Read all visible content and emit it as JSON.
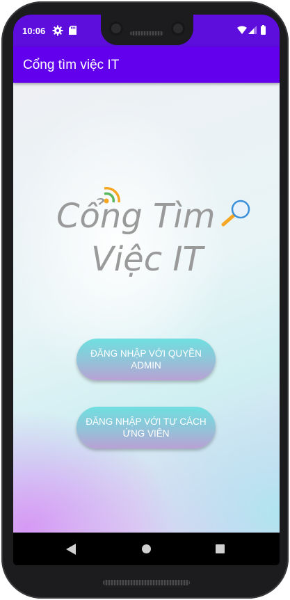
{
  "status_bar": {
    "time": "10:06",
    "icons": [
      "settings-icon",
      "sd-card-icon",
      "wifi-icon",
      "signal-icon",
      "battery-icon"
    ],
    "color": "#5d0edc"
  },
  "app_bar": {
    "title": "Cổng tìm việc IT",
    "color": "#6200ee"
  },
  "logo": {
    "line1": "Cổng Tìm",
    "line2": "Việc IT",
    "icons": [
      "wifi-signal-icon",
      "magnifier-icon"
    ]
  },
  "buttons": {
    "admin_login": "ĐĂNG NHẬP VỚI QUYỀN\nADMIN",
    "candidate_login": "ĐĂNG NHẬP VỚI TƯ CÁCH\nỨNG VIÊN"
  },
  "nav_bar": {
    "icons": [
      "back-icon",
      "home-icon",
      "recents-icon"
    ]
  }
}
